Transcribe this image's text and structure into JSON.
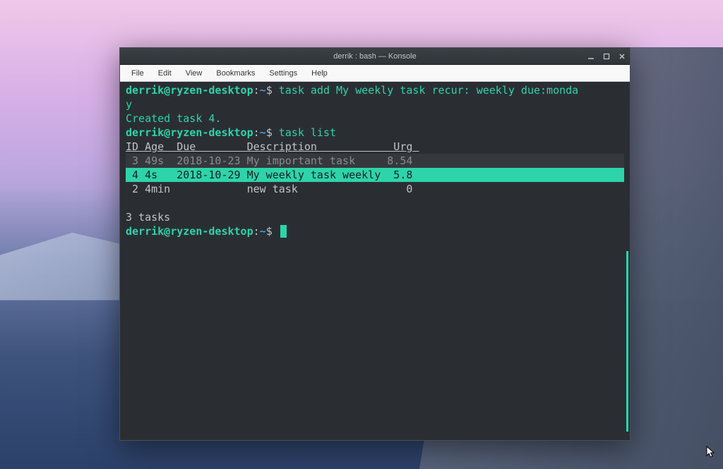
{
  "window": {
    "title": "derrik : bash — Konsole"
  },
  "menu": {
    "file": "File",
    "edit": "Edit",
    "view": "View",
    "bookmarks": "Bookmarks",
    "settings": "Settings",
    "help": "Help"
  },
  "prompt": {
    "userhost": "derrik@ryzen-desktop",
    "sep": ":",
    "path": "~",
    "sym": "$"
  },
  "commands": {
    "cmd1_part1": " task add My weekly task recur: weekly due:monda",
    "cmd1_wrap": "y",
    "cmd2": " task list"
  },
  "output": {
    "created": "Created task 4.",
    "blank": "",
    "header": "ID Age  Due        Description            Urg ",
    "row1": " 3 49s  2018-10-23 My important task     8.54",
    "row2": " 4 4s   2018-10-29 My weekly task weekly  5.8",
    "row3": " 2 4min            new task                 0",
    "summary": "3 tasks"
  },
  "table": {
    "columns": [
      "ID",
      "Age",
      "Due",
      "Description",
      "Urg"
    ],
    "rows": [
      {
        "id": 3,
        "age": "49s",
        "due": "2018-10-23",
        "description": "My important task",
        "urg": 8.54
      },
      {
        "id": 4,
        "age": "4s",
        "due": "2018-10-29",
        "description": "My weekly task weekly",
        "urg": 5.8
      },
      {
        "id": 2,
        "age": "4min",
        "due": "",
        "description": "new task",
        "urg": 0
      }
    ]
  }
}
